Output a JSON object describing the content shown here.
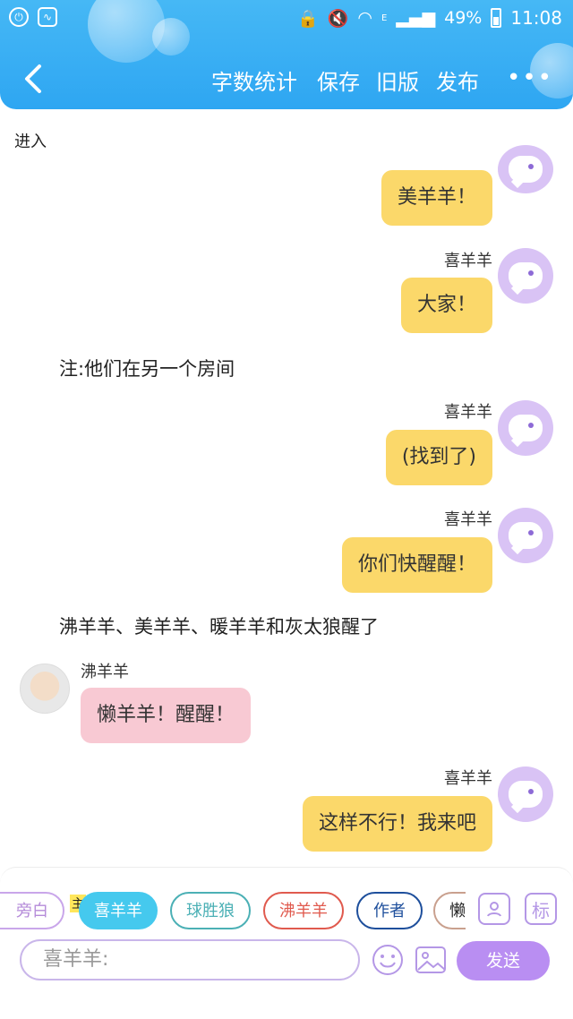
{
  "status_bar": {
    "battery": "49%",
    "time": "11:08",
    "network": "E"
  },
  "toolbar": {
    "word_count": "字数统计",
    "save": "保存",
    "old_version": "旧版",
    "publish": "发布",
    "more": "•••"
  },
  "chat": {
    "enter_label": "进入",
    "messages": [
      {
        "kind": "right",
        "speaker": "",
        "text": "美羊羊！"
      },
      {
        "kind": "right",
        "speaker": "喜羊羊",
        "text": "大家！"
      },
      {
        "kind": "narration",
        "text": "注:他们在另一个房间"
      },
      {
        "kind": "right",
        "speaker": "喜羊羊",
        "text": "(找到了)"
      },
      {
        "kind": "right",
        "speaker": "喜羊羊",
        "text": "你们快醒醒！"
      },
      {
        "kind": "narration",
        "text": "沸羊羊、美羊羊、暖羊羊和灰太狼醒了"
      },
      {
        "kind": "left",
        "speaker": "沸羊羊",
        "text": "懒羊羊！醒醒！"
      },
      {
        "kind": "right",
        "speaker": "喜羊羊",
        "text": "这样不行！我来吧"
      }
    ]
  },
  "role_bar": {
    "narrator_label": "旁白",
    "main_badge": "主",
    "roles": [
      {
        "label": "喜羊羊",
        "color": "#45c9ee"
      },
      {
        "label": "球胜狼",
        "color": "#4bb0b5"
      },
      {
        "label": "沸羊羊",
        "color": "#e05a4e"
      },
      {
        "label": "作者",
        "color": "#1e4f9c"
      },
      {
        "label": "懒",
        "color": "#c9a08e"
      }
    ],
    "mark_label": "标"
  },
  "composer": {
    "input_value": "喜羊羊:",
    "send_label": "发送"
  }
}
